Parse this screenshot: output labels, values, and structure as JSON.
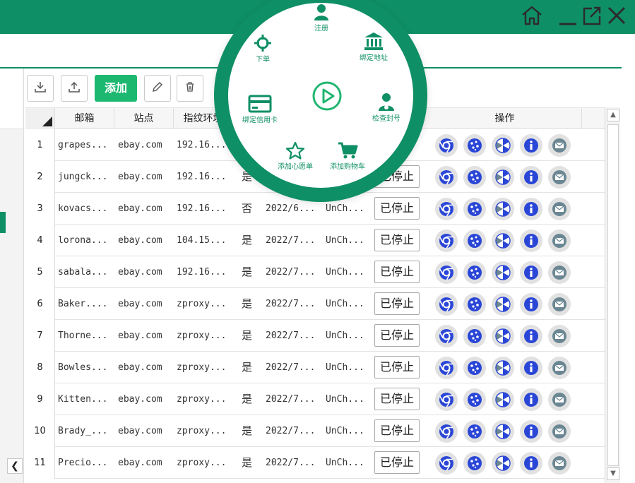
{
  "window": {
    "controls": [
      "home-icon",
      "minimize-icon",
      "maximize-icon",
      "close-icon"
    ]
  },
  "toolbar": {
    "add_label": "添加",
    "icons": [
      "download-icon",
      "upload-icon",
      "edit-icon",
      "delete-icon"
    ]
  },
  "table": {
    "columns": [
      "邮箱",
      "站点",
      "指纹环境",
      "操作"
    ],
    "rows": [
      {
        "num": "1",
        "email": "grapes...",
        "site": "ebay.com",
        "fingerprint": "192.16...",
        "flag": "",
        "date": "",
        "name": "",
        "status": ""
      },
      {
        "num": "2",
        "email": "jungck...",
        "site": "ebay.com",
        "fingerprint": "192.16...",
        "flag": "是",
        "date": "",
        "name": "",
        "status": "已停止"
      },
      {
        "num": "3",
        "email": "kovacs...",
        "site": "ebay.com",
        "fingerprint": "192.16...",
        "flag": "否",
        "date": "2022/6...",
        "name": "UnCh...",
        "status": "已停止"
      },
      {
        "num": "4",
        "email": "lorona...",
        "site": "ebay.com",
        "fingerprint": "104.15...",
        "flag": "是",
        "date": "2022/7...",
        "name": "UnCh...",
        "status": "已停止"
      },
      {
        "num": "5",
        "email": "sabala...",
        "site": "ebay.com",
        "fingerprint": "192.16...",
        "flag": "是",
        "date": "2022/7...",
        "name": "UnCh...",
        "status": "已停止"
      },
      {
        "num": "6",
        "email": "Baker....",
        "site": "ebay.com",
        "fingerprint": "zproxy...",
        "flag": "是",
        "date": "2022/7...",
        "name": "UnCh...",
        "status": "已停止"
      },
      {
        "num": "7",
        "email": "Thorne...",
        "site": "ebay.com",
        "fingerprint": "zproxy...",
        "flag": "是",
        "date": "2022/7...",
        "name": "UnCh...",
        "status": "已停止"
      },
      {
        "num": "8",
        "email": "Bowles...",
        "site": "ebay.com",
        "fingerprint": "zproxy...",
        "flag": "是",
        "date": "2022/7...",
        "name": "UnCh...",
        "status": "已停止"
      },
      {
        "num": "9",
        "email": "Kitten...",
        "site": "ebay.com",
        "fingerprint": "zproxy...",
        "flag": "是",
        "date": "2022/7...",
        "name": "UnCh...",
        "status": "已停止"
      },
      {
        "num": "10",
        "email": "Brady_...",
        "site": "ebay.com",
        "fingerprint": "zproxy...",
        "flag": "是",
        "date": "2022/7...",
        "name": "UnCh...",
        "status": "已停止"
      },
      {
        "num": "11",
        "email": "Precio...",
        "site": "ebay.com",
        "fingerprint": "zproxy...",
        "flag": "是",
        "date": "2022/7...",
        "name": "UnCh...",
        "status": "已停止"
      }
    ],
    "row_action_icons": [
      "chrome-icon",
      "cookie-icon",
      "fan-icon",
      "info-icon",
      "mail-icon"
    ]
  },
  "radial_menu": {
    "items": {
      "register": "注册",
      "order": "下单",
      "bind_address": "绑定地址",
      "bind_card": "绑定信用卡",
      "check_account": "检查封号",
      "wishlist": "添加心愿单",
      "cart": "添加购物车"
    },
    "center_icon": "play-icon"
  },
  "colors": {
    "brand_green": "#0f8f66",
    "add_button": "#1cb870",
    "icon_blue": "#2a46d6",
    "icon_gray": "#6b8793"
  }
}
